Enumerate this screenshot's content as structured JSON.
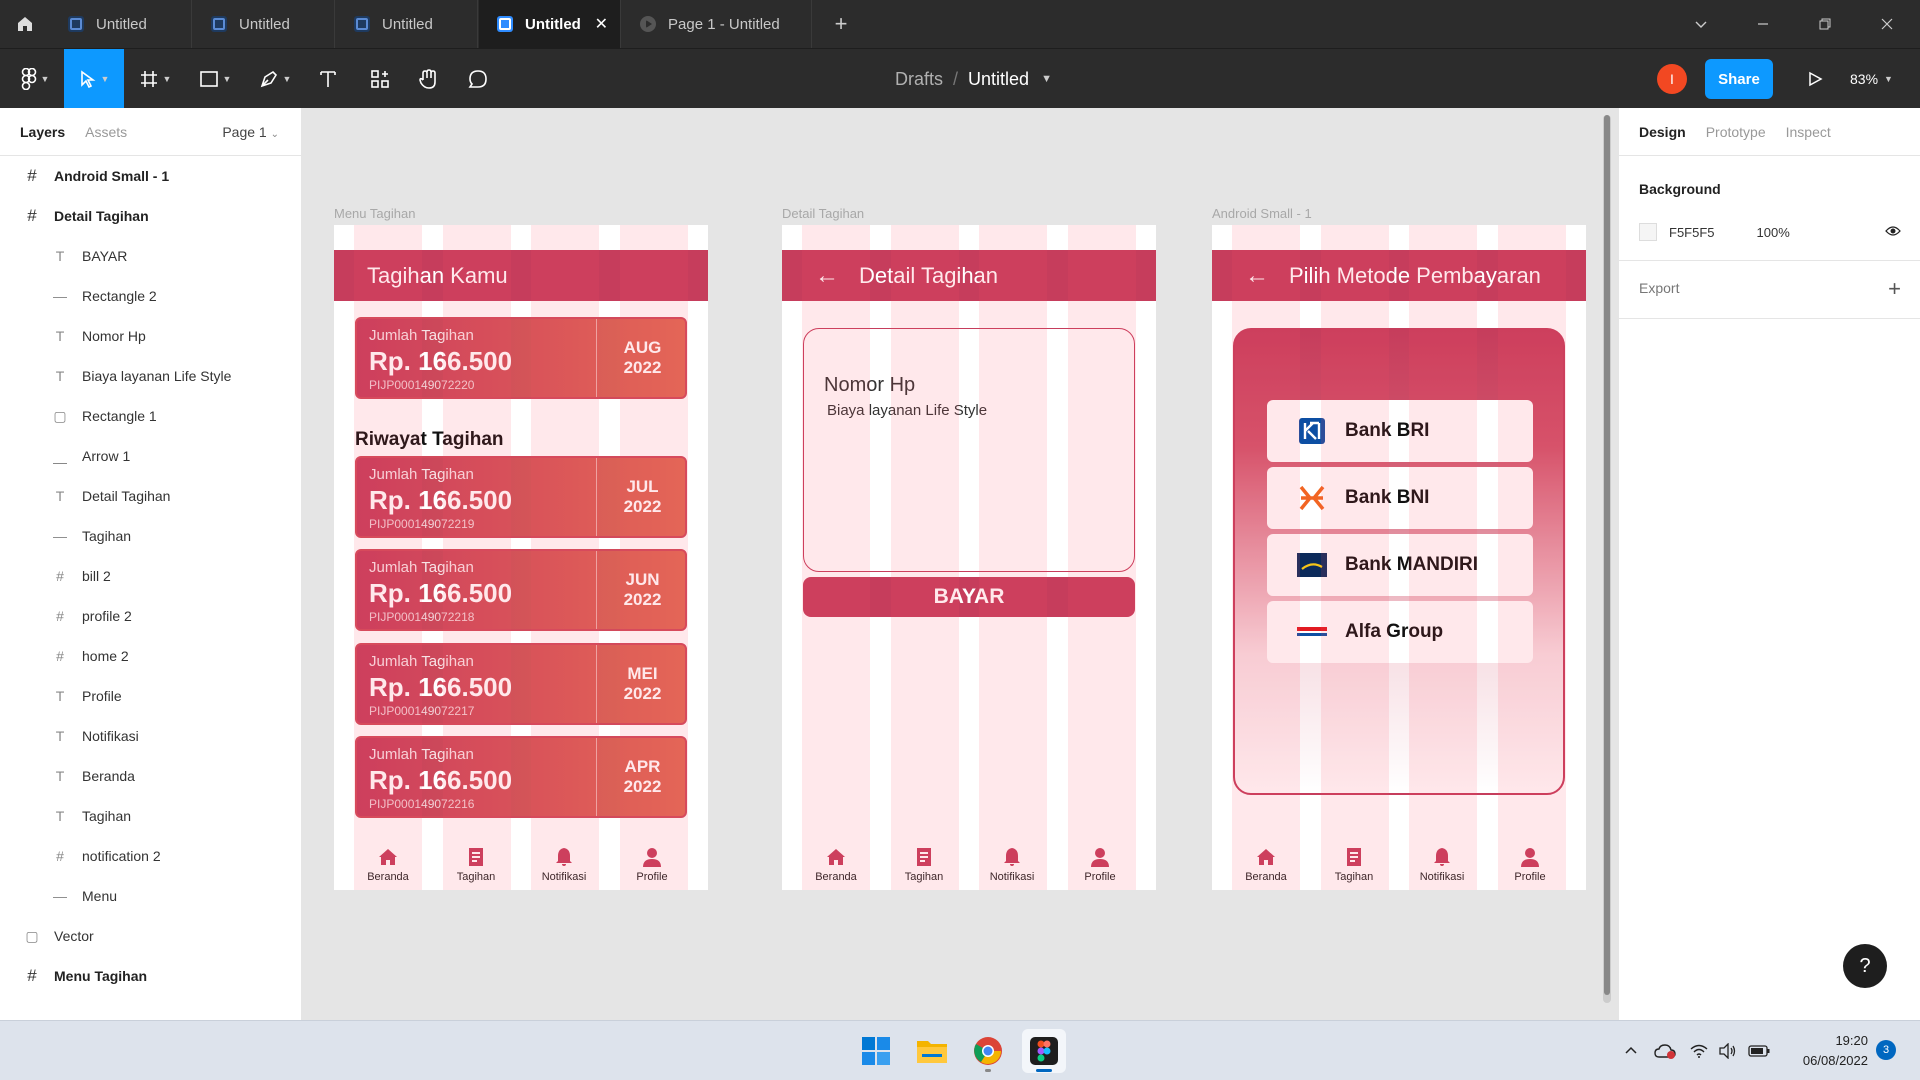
{
  "tabs": [
    {
      "label": "Untitled",
      "active": false
    },
    {
      "label": "Untitled",
      "active": false
    },
    {
      "label": "Untitled",
      "active": false
    },
    {
      "label": "Untitled",
      "active": true
    },
    {
      "label": "Page 1 - Untitled",
      "active": false
    }
  ],
  "toolbar": {
    "breadcrumb_parent": "Drafts",
    "breadcrumb_sep": "/",
    "file_name": "Untitled",
    "avatar_initial": "I",
    "share_label": "Share",
    "zoom": "83%"
  },
  "left_panel": {
    "tab_layers": "Layers",
    "tab_assets": "Assets",
    "page": "Page 1",
    "layers": [
      {
        "name": "Android Small - 1",
        "type": "frame",
        "level": 0
      },
      {
        "name": "Detail Tagihan",
        "type": "frame",
        "level": 0
      },
      {
        "name": "BAYAR",
        "type": "text",
        "level": 1
      },
      {
        "name": "Rectangle 2",
        "type": "line",
        "level": 1
      },
      {
        "name": "Nomor Hp",
        "type": "text",
        "level": 1
      },
      {
        "name": "Biaya layanan Life Style",
        "type": "text",
        "level": 1
      },
      {
        "name": "Rectangle 1",
        "type": "rect",
        "level": 1
      },
      {
        "name": "Arrow 1",
        "type": "arrow",
        "level": 1
      },
      {
        "name": "Detail Tagihan",
        "type": "text",
        "level": 1
      },
      {
        "name": "Tagihan",
        "type": "line",
        "level": 1
      },
      {
        "name": "bill 2",
        "type": "frame",
        "level": 1
      },
      {
        "name": "profile 2",
        "type": "frame",
        "level": 1
      },
      {
        "name": "home 2",
        "type": "frame",
        "level": 1
      },
      {
        "name": "Profile",
        "type": "text",
        "level": 1
      },
      {
        "name": "Notifikasi",
        "type": "text",
        "level": 1
      },
      {
        "name": "Beranda",
        "type": "text",
        "level": 1
      },
      {
        "name": "Tagihan",
        "type": "text",
        "level": 1
      },
      {
        "name": "notification 2",
        "type": "frame",
        "level": 1
      },
      {
        "name": "Menu",
        "type": "line",
        "level": 1
      },
      {
        "name": "Vector",
        "type": "rect",
        "level": 0.5
      },
      {
        "name": "Menu Tagihan",
        "type": "frame",
        "level": 0
      }
    ]
  },
  "canvas": {
    "frame1": {
      "label": "Menu Tagihan",
      "header": "Tagihan Kamu",
      "riwayat": "Riwayat Tagihan",
      "bills": [
        {
          "sub": "Jumlah Tagihan",
          "amount": "Rp. 166.500",
          "code": "PIJP000149072220",
          "month": "AUG",
          "year": "2022"
        },
        {
          "sub": "Jumlah Tagihan",
          "amount": "Rp. 166.500",
          "code": "PIJP000149072219",
          "month": "JUL",
          "year": "2022"
        },
        {
          "sub": "Jumlah Tagihan",
          "amount": "Rp. 166.500",
          "code": "PIJP000149072218",
          "month": "JUN",
          "year": "2022"
        },
        {
          "sub": "Jumlah Tagihan",
          "amount": "Rp. 166.500",
          "code": "PIJP000149072217",
          "month": "MEI",
          "year": "2022"
        },
        {
          "sub": "Jumlah Tagihan",
          "amount": "Rp. 166.500",
          "code": "PIJP000149072216",
          "month": "APR",
          "year": "2022"
        }
      ]
    },
    "frame2": {
      "label": "Detail Tagihan",
      "header": "Detail Tagihan",
      "nomor_hp": "Nomor Hp",
      "biaya": "Biaya layanan Life Style",
      "bayar": "BAYAR"
    },
    "frame3": {
      "label": "Android Small - 1",
      "header": "Pilih Metode Pembayaran",
      "banks": [
        "Bank BRI",
        "Bank BNI",
        "Bank MANDIRI",
        "Alfa Group"
      ]
    },
    "nav": {
      "home": "Beranda",
      "bills": "Tagihan",
      "notif": "Notifikasi",
      "profile": "Profile"
    }
  },
  "right_panel": {
    "tab_design": "Design",
    "tab_prototype": "Prototype",
    "tab_inspect": "Inspect",
    "background_title": "Background",
    "bg_color": "F5F5F5",
    "bg_opacity": "100%",
    "export_label": "Export"
  },
  "taskbar": {
    "time": "19:20",
    "date": "06/08/2022",
    "notifications": "3"
  },
  "colors": {
    "accent": "#0d99ff",
    "brand_red": "#c63d5c",
    "figma_dark": "#2c2c2c"
  }
}
